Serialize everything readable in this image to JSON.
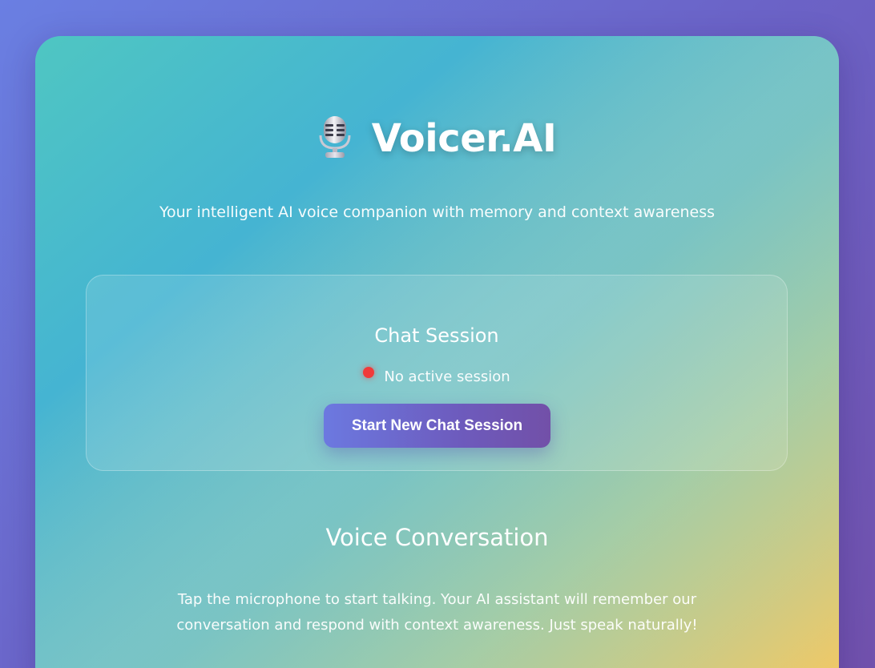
{
  "header": {
    "app_title": "Voicer.AI",
    "subtitle": "Your intelligent AI voice companion with memory and context awareness",
    "icon": "microphone-icon"
  },
  "session": {
    "title": "Chat Session",
    "status_text": "No active session",
    "status_color": "#f03a3a",
    "start_button_label": "Start New Chat Session"
  },
  "voice": {
    "title": "Voice Conversation",
    "description": "Tap the microphone to start talking. Your AI assistant will remember our conversation and respond with context awareness. Just speak naturally!"
  },
  "colors": {
    "page_background": "#6b63c7",
    "button_gradient_start": "#6c79e0",
    "button_gradient_end": "#7250a8"
  }
}
